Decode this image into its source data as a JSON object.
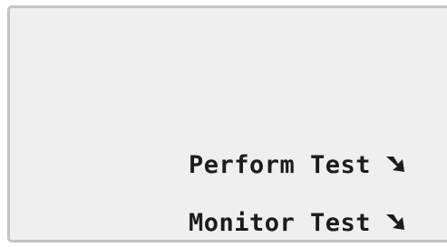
{
  "menu": {
    "items": [
      {
        "label": "Perform Test",
        "icon": "enter-arrow-icon"
      },
      {
        "label": "Monitor Test",
        "icon": "enter-arrow-icon"
      }
    ]
  },
  "colors": {
    "screen_background": "#efefef",
    "border": "#c4c4c4",
    "text": "#1c1c1c"
  }
}
